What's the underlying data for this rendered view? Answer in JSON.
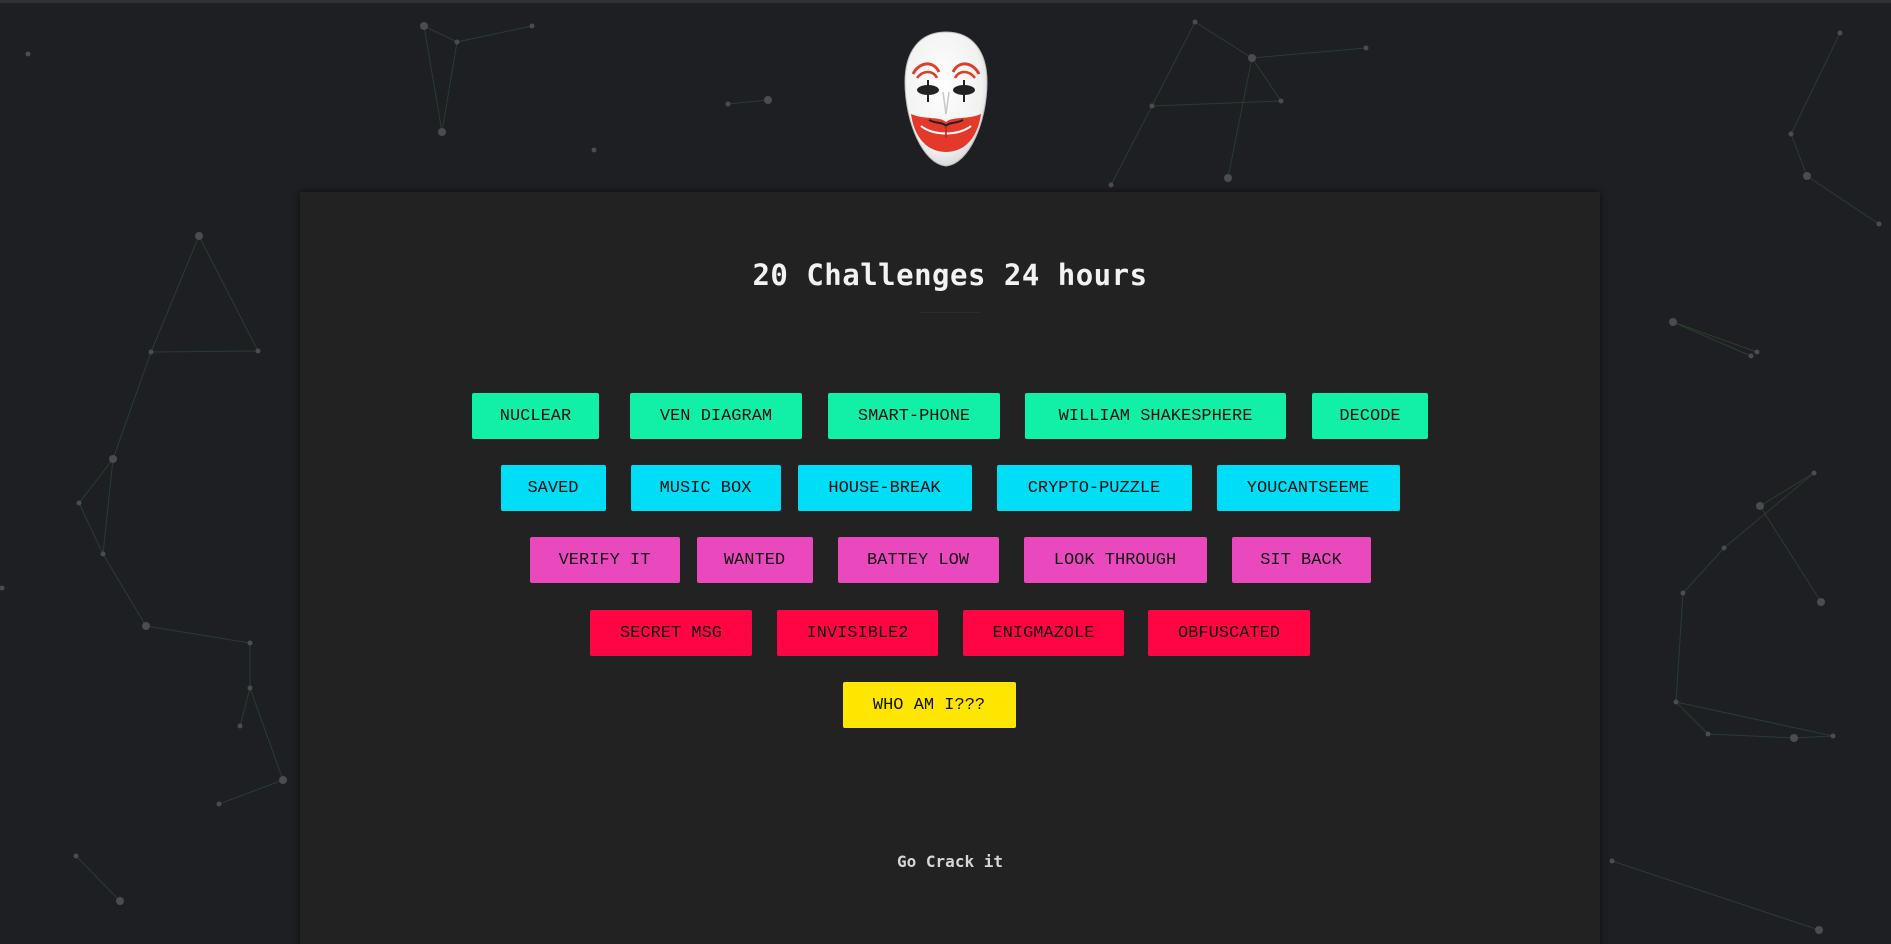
{
  "page": {
    "title": "20 Challenges 24 hours",
    "footer": "Go Crack it"
  },
  "colors": {
    "background": "#1e1f22",
    "panel": "#222222",
    "row_1": "#12f0a8",
    "row_2": "#00ddf7",
    "row_3": "#ea49be",
    "row_4": "#ff0544",
    "row_5": "#ffe600"
  },
  "challenges": [
    {
      "label": "NUCLEAR",
      "row": 1
    },
    {
      "label": "VEN DIAGRAM",
      "row": 1
    },
    {
      "label": "SMART-PHONE",
      "row": 1
    },
    {
      "label": "WILLIAM SHAKESPHERE",
      "row": 1
    },
    {
      "label": "DECODE",
      "row": 1
    },
    {
      "label": "SAVED",
      "row": 2
    },
    {
      "label": "MUSIC BOX",
      "row": 2
    },
    {
      "label": "HOUSE-BREAK",
      "row": 2
    },
    {
      "label": "CRYPTO-PUZZLE",
      "row": 2
    },
    {
      "label": "YOUCANTSEEME",
      "row": 2
    },
    {
      "label": "VERIFY IT",
      "row": 3
    },
    {
      "label": "WANTED",
      "row": 3
    },
    {
      "label": "BATTEY LOW",
      "row": 3
    },
    {
      "label": "LOOK THROUGH",
      "row": 3
    },
    {
      "label": "SIT BACK",
      "row": 3
    },
    {
      "label": "SECRET MSG",
      "row": 4
    },
    {
      "label": "INVISIBLE2",
      "row": 4
    },
    {
      "label": "ENIGMAZOLE",
      "row": 4
    },
    {
      "label": "OBFUSCATED",
      "row": 4
    },
    {
      "label": "WHO AM I???",
      "row": 5
    }
  ],
  "icons": {
    "logo": "clown-mask-icon"
  }
}
